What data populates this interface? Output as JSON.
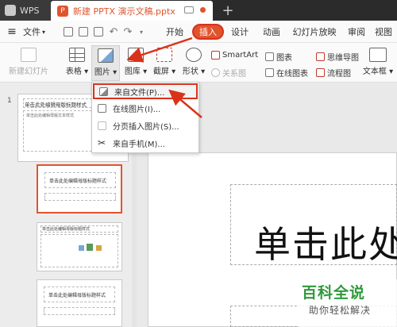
{
  "app": {
    "name": "WPS"
  },
  "tabs": {
    "document_title": "新建 PPTX 演示文稿.pptx",
    "new_tab": "+"
  },
  "menu": {
    "file": "文件",
    "items": [
      "开始",
      "插入",
      "设计",
      "动画",
      "幻灯片放映",
      "审阅",
      "视图"
    ]
  },
  "ribbon": {
    "new_slide": "新建幻灯片",
    "table": "表格",
    "picture": "图片",
    "gallery": "图库",
    "crop": "截屏",
    "shapes": "形状",
    "smartart": "SmartArt",
    "chart": "图表",
    "mindmap": "思维导图",
    "relation": "关系图",
    "online_chart": "在线图表",
    "flowchart": "流程图",
    "textbox": "文本框"
  },
  "picture_menu": {
    "items": [
      {
        "label": "来自文件(P)...",
        "icon": "image-file-icon",
        "enabled": true
      },
      {
        "label": "在线图片(I)...",
        "icon": "online-image-icon",
        "enabled": true
      },
      {
        "label": "分页插入图片(S)...",
        "icon": "paged-image-icon",
        "enabled": false
      },
      {
        "label": "来自手机(M)...",
        "icon": "phone-scan-icon",
        "enabled": true
      }
    ]
  },
  "slides": {
    "slide1_number": "1",
    "thumb1_title": "单击此处编辑母版标题样式",
    "thumb1_body": "单击此处编辑母版文本样式",
    "thumb2_title": "单击此处编辑母版标题样式",
    "thumb3_title": "单击此处编辑母版标题样式",
    "thumb4_title": "单击此处编辑母版标题样式"
  },
  "canvas": {
    "title_text": "单击此处"
  },
  "watermark": {
    "brand": "百科全说",
    "tagline": "助你轻松解决"
  },
  "colors": {
    "accent": "#e0542d",
    "highlight_border": "#d9321a",
    "watermark_green": "#2e9a3a"
  }
}
